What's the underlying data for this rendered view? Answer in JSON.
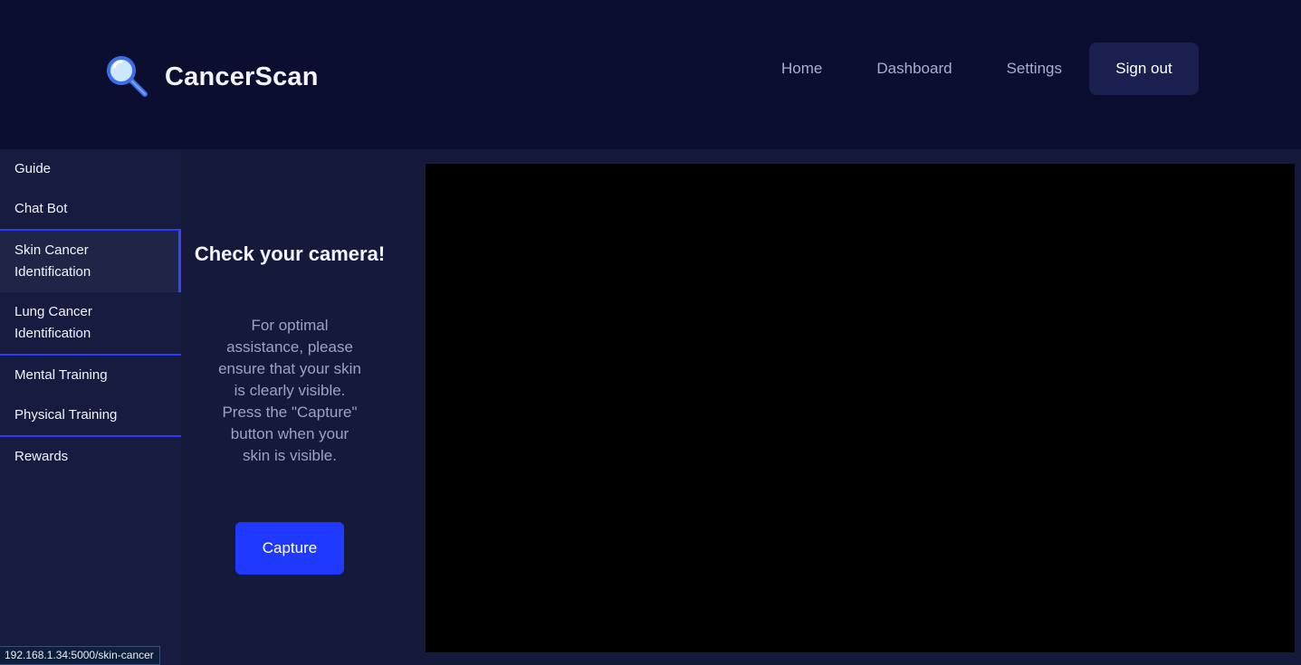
{
  "header": {
    "brand_title": "CancerScan",
    "brand_icon": "magnifying-glass-icon",
    "nav": [
      "Home",
      "Dashboard",
      "Settings"
    ],
    "signout_label": "Sign out"
  },
  "sidebar": {
    "guide": "Guide",
    "chatbot": "Chat Bot",
    "skin": "Skin Cancer Identification",
    "lung": "Lung Cancer Identification",
    "mental": "Mental Training",
    "physical": "Physical Training",
    "rewards": "Rewards"
  },
  "panel": {
    "title": "Check your camera!",
    "description": "For optimal assistance, please ensure that your skin is clearly visible. Press the \"Capture\" button when your skin is visible.",
    "capture_label": "Capture"
  },
  "statusbar": {
    "url": "192.168.1.34:5000/skin-cancer"
  },
  "colors": {
    "accent": "#1f39ff",
    "background": "#0b0e2e",
    "sidebar": "#181b40"
  }
}
